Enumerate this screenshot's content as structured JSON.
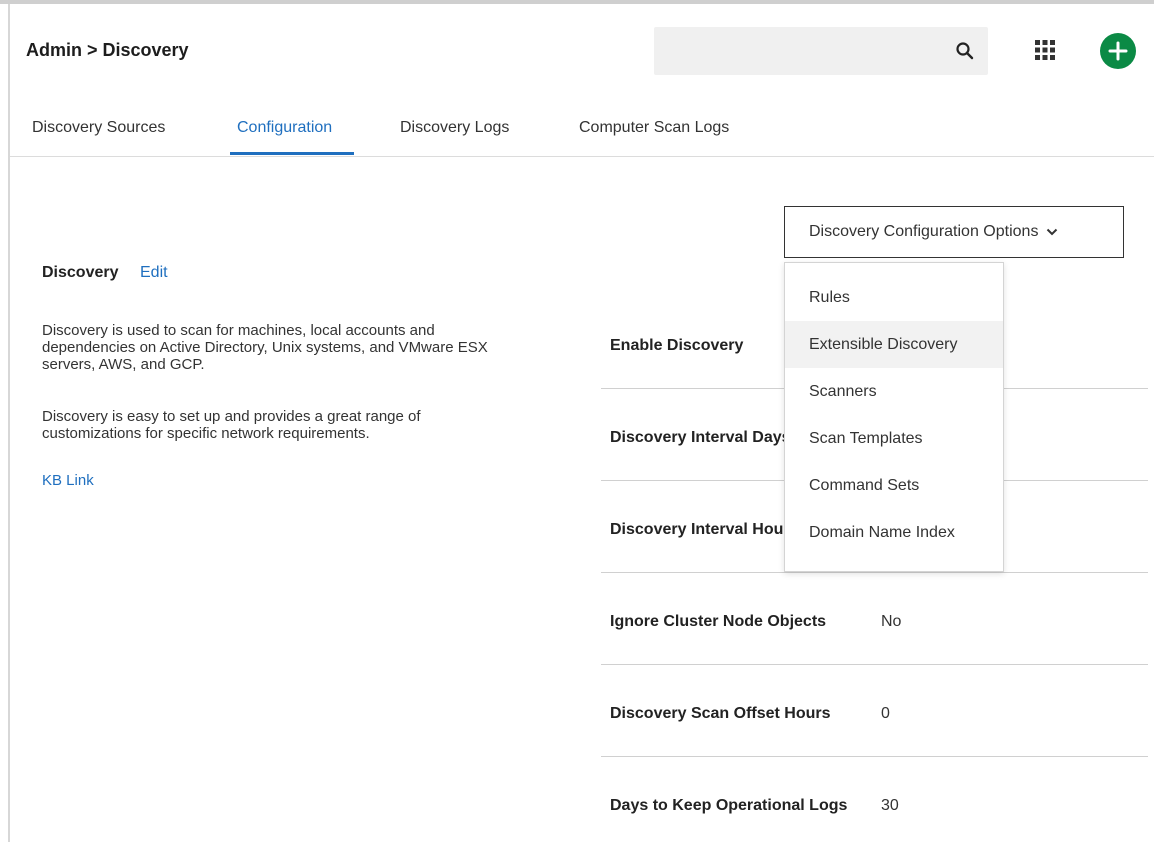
{
  "header": {
    "breadcrumb": "Admin > Discovery",
    "search": {
      "placeholder": "",
      "value": ""
    },
    "icons": {
      "search": "search-icon",
      "apps": "apps-grid-icon",
      "add": "add-icon"
    },
    "accent_color": "#0b8a45"
  },
  "tabs": [
    {
      "label": "Discovery Sources",
      "active": false
    },
    {
      "label": "Configuration",
      "active": true
    },
    {
      "label": "Discovery Logs",
      "active": false
    },
    {
      "label": "Computer Scan Logs",
      "active": false
    }
  ],
  "info": {
    "title": "Discovery",
    "edit_label": "Edit",
    "paragraph1": "Discovery is used to scan for machines, local accounts and dependencies on Active Directory, Unix systems, and VMware ESX servers, AWS, and GCP.",
    "paragraph2": "Discovery is easy to set up and provides a great range of customizations for specific network requirements.",
    "kb_link": "KB Link"
  },
  "options": {
    "button_label": "Discovery Configuration Options",
    "menu_items": [
      "Rules",
      "Extensible Discovery",
      "Scanners",
      "Scan Templates",
      "Command Sets",
      "Domain Name Index"
    ],
    "hovered_item": "Extensible Discovery"
  },
  "settings": [
    {
      "label": "Enable Discovery",
      "value": ""
    },
    {
      "label": "Discovery Interval Days",
      "value": ""
    },
    {
      "label": "Discovery Interval Hours",
      "value": ""
    },
    {
      "label": "Ignore Cluster Node Objects",
      "value": "No"
    },
    {
      "label": "Discovery Scan Offset Hours",
      "value": "0"
    },
    {
      "label": "Days to Keep Operational Logs",
      "value": "30"
    }
  ],
  "colors": {
    "link": "#1f6fbf",
    "active_tab": "#1f6fbf"
  }
}
